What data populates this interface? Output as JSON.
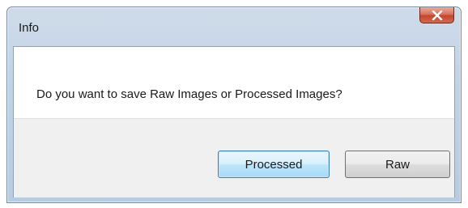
{
  "window": {
    "title": "Info",
    "close_icon": "close-icon"
  },
  "message": "Do you want to save Raw Images or Processed Images?",
  "buttons": {
    "processed_label": "Processed",
    "raw_label": "Raw"
  },
  "colors": {
    "frame": "#c3d3e6",
    "close_button": "#c4452b",
    "default_button_border": "#3c7fb1",
    "footer": "#f0f0f0"
  }
}
